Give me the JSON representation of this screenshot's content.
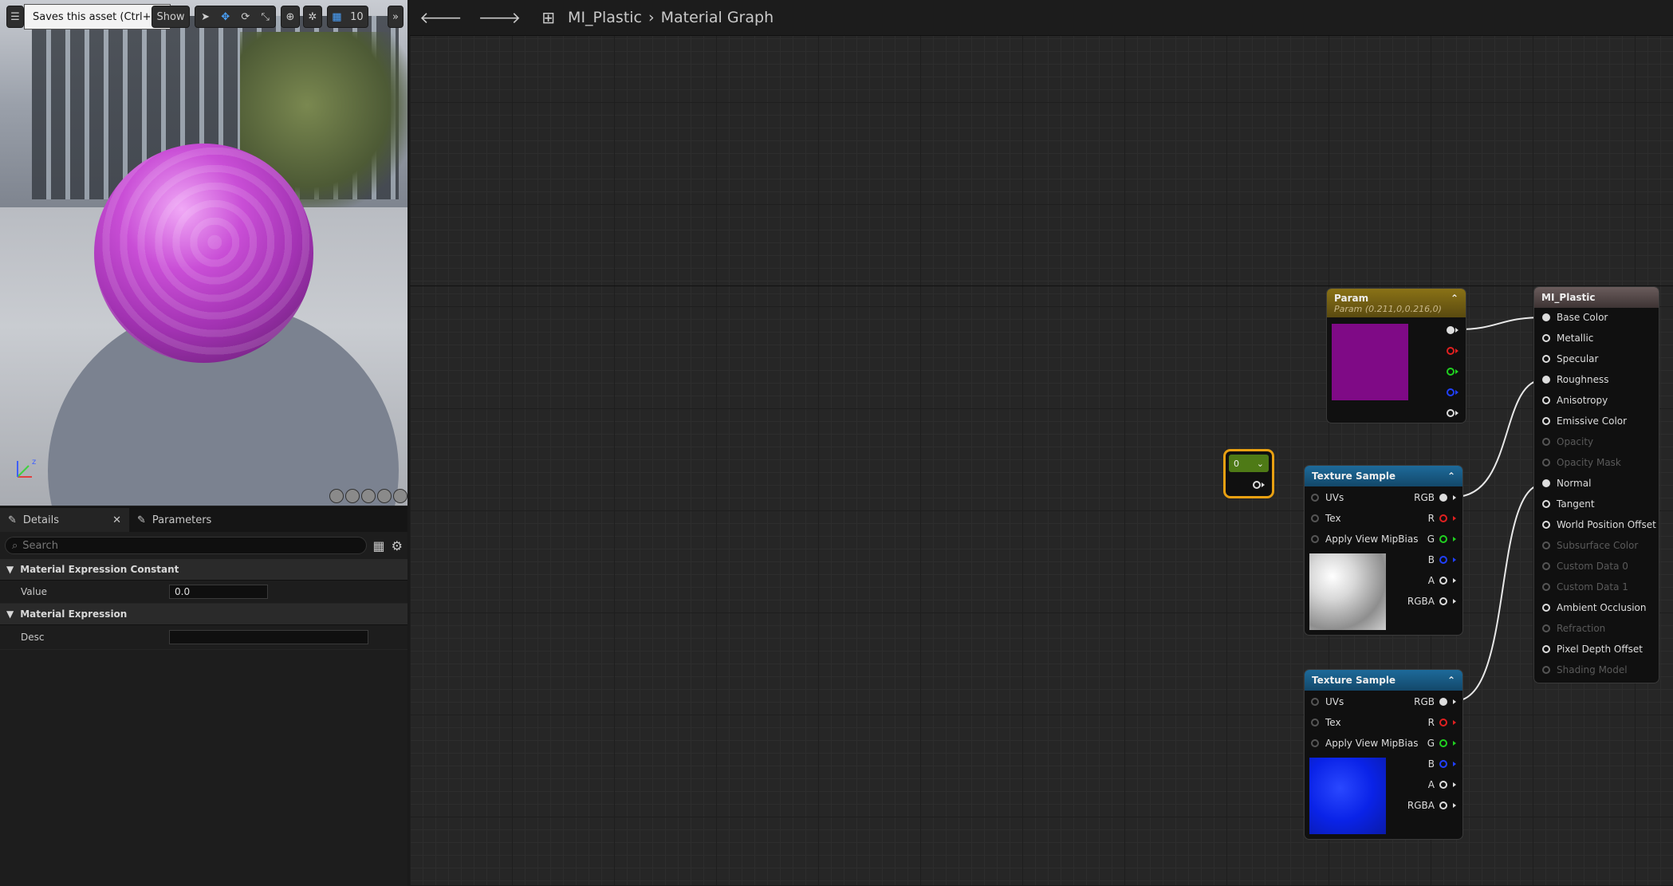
{
  "tooltip": "Saves this asset (Ctrl+S)",
  "viewport": {
    "show_label": "Show",
    "grid_snap": "10"
  },
  "breadcrumb": {
    "asset": "MI_Plastic",
    "graph": "Material Graph"
  },
  "details": {
    "tabs": [
      {
        "label": "Details"
      },
      {
        "label": "Parameters"
      }
    ],
    "search_placeholder": "Search",
    "sections": [
      {
        "title": "Material Expression Constant",
        "props": [
          {
            "name": "Value",
            "value": "0.0"
          }
        ]
      },
      {
        "title": "Material Expression",
        "props": [
          {
            "name": "Desc",
            "value": ""
          }
        ]
      }
    ]
  },
  "nodes": {
    "param": {
      "title": "Param",
      "subtitle": "Param (0.211,0,0.216,0)",
      "color": "#7f0a86"
    },
    "constant": {
      "value": "0"
    },
    "tex1": {
      "title": "Texture Sample",
      "inputs": [
        "UVs",
        "Tex",
        "Apply View MipBias"
      ],
      "outputs": [
        "RGB",
        "R",
        "G",
        "B",
        "A",
        "RGBA"
      ]
    },
    "tex2": {
      "title": "Texture Sample",
      "inputs": [
        "UVs",
        "Tex",
        "Apply View MipBias"
      ],
      "outputs": [
        "RGB",
        "R",
        "G",
        "B",
        "A",
        "RGBA"
      ],
      "color": "#0a23e8"
    },
    "result": {
      "title": "MI_Plastic",
      "pins": [
        {
          "label": "Base Color",
          "enabled": true
        },
        {
          "label": "Metallic",
          "enabled": true
        },
        {
          "label": "Specular",
          "enabled": true
        },
        {
          "label": "Roughness",
          "enabled": true
        },
        {
          "label": "Anisotropy",
          "enabled": true
        },
        {
          "label": "Emissive Color",
          "enabled": true
        },
        {
          "label": "Opacity",
          "enabled": false
        },
        {
          "label": "Opacity Mask",
          "enabled": false
        },
        {
          "label": "Normal",
          "enabled": true
        },
        {
          "label": "Tangent",
          "enabled": true
        },
        {
          "label": "World Position Offset",
          "enabled": true
        },
        {
          "label": "Subsurface Color",
          "enabled": false
        },
        {
          "label": "Custom Data 0",
          "enabled": false
        },
        {
          "label": "Custom Data 1",
          "enabled": false
        },
        {
          "label": "Ambient Occlusion",
          "enabled": true
        },
        {
          "label": "Refraction",
          "enabled": false
        },
        {
          "label": "Pixel Depth Offset",
          "enabled": true
        },
        {
          "label": "Shading Model",
          "enabled": false
        }
      ]
    }
  }
}
